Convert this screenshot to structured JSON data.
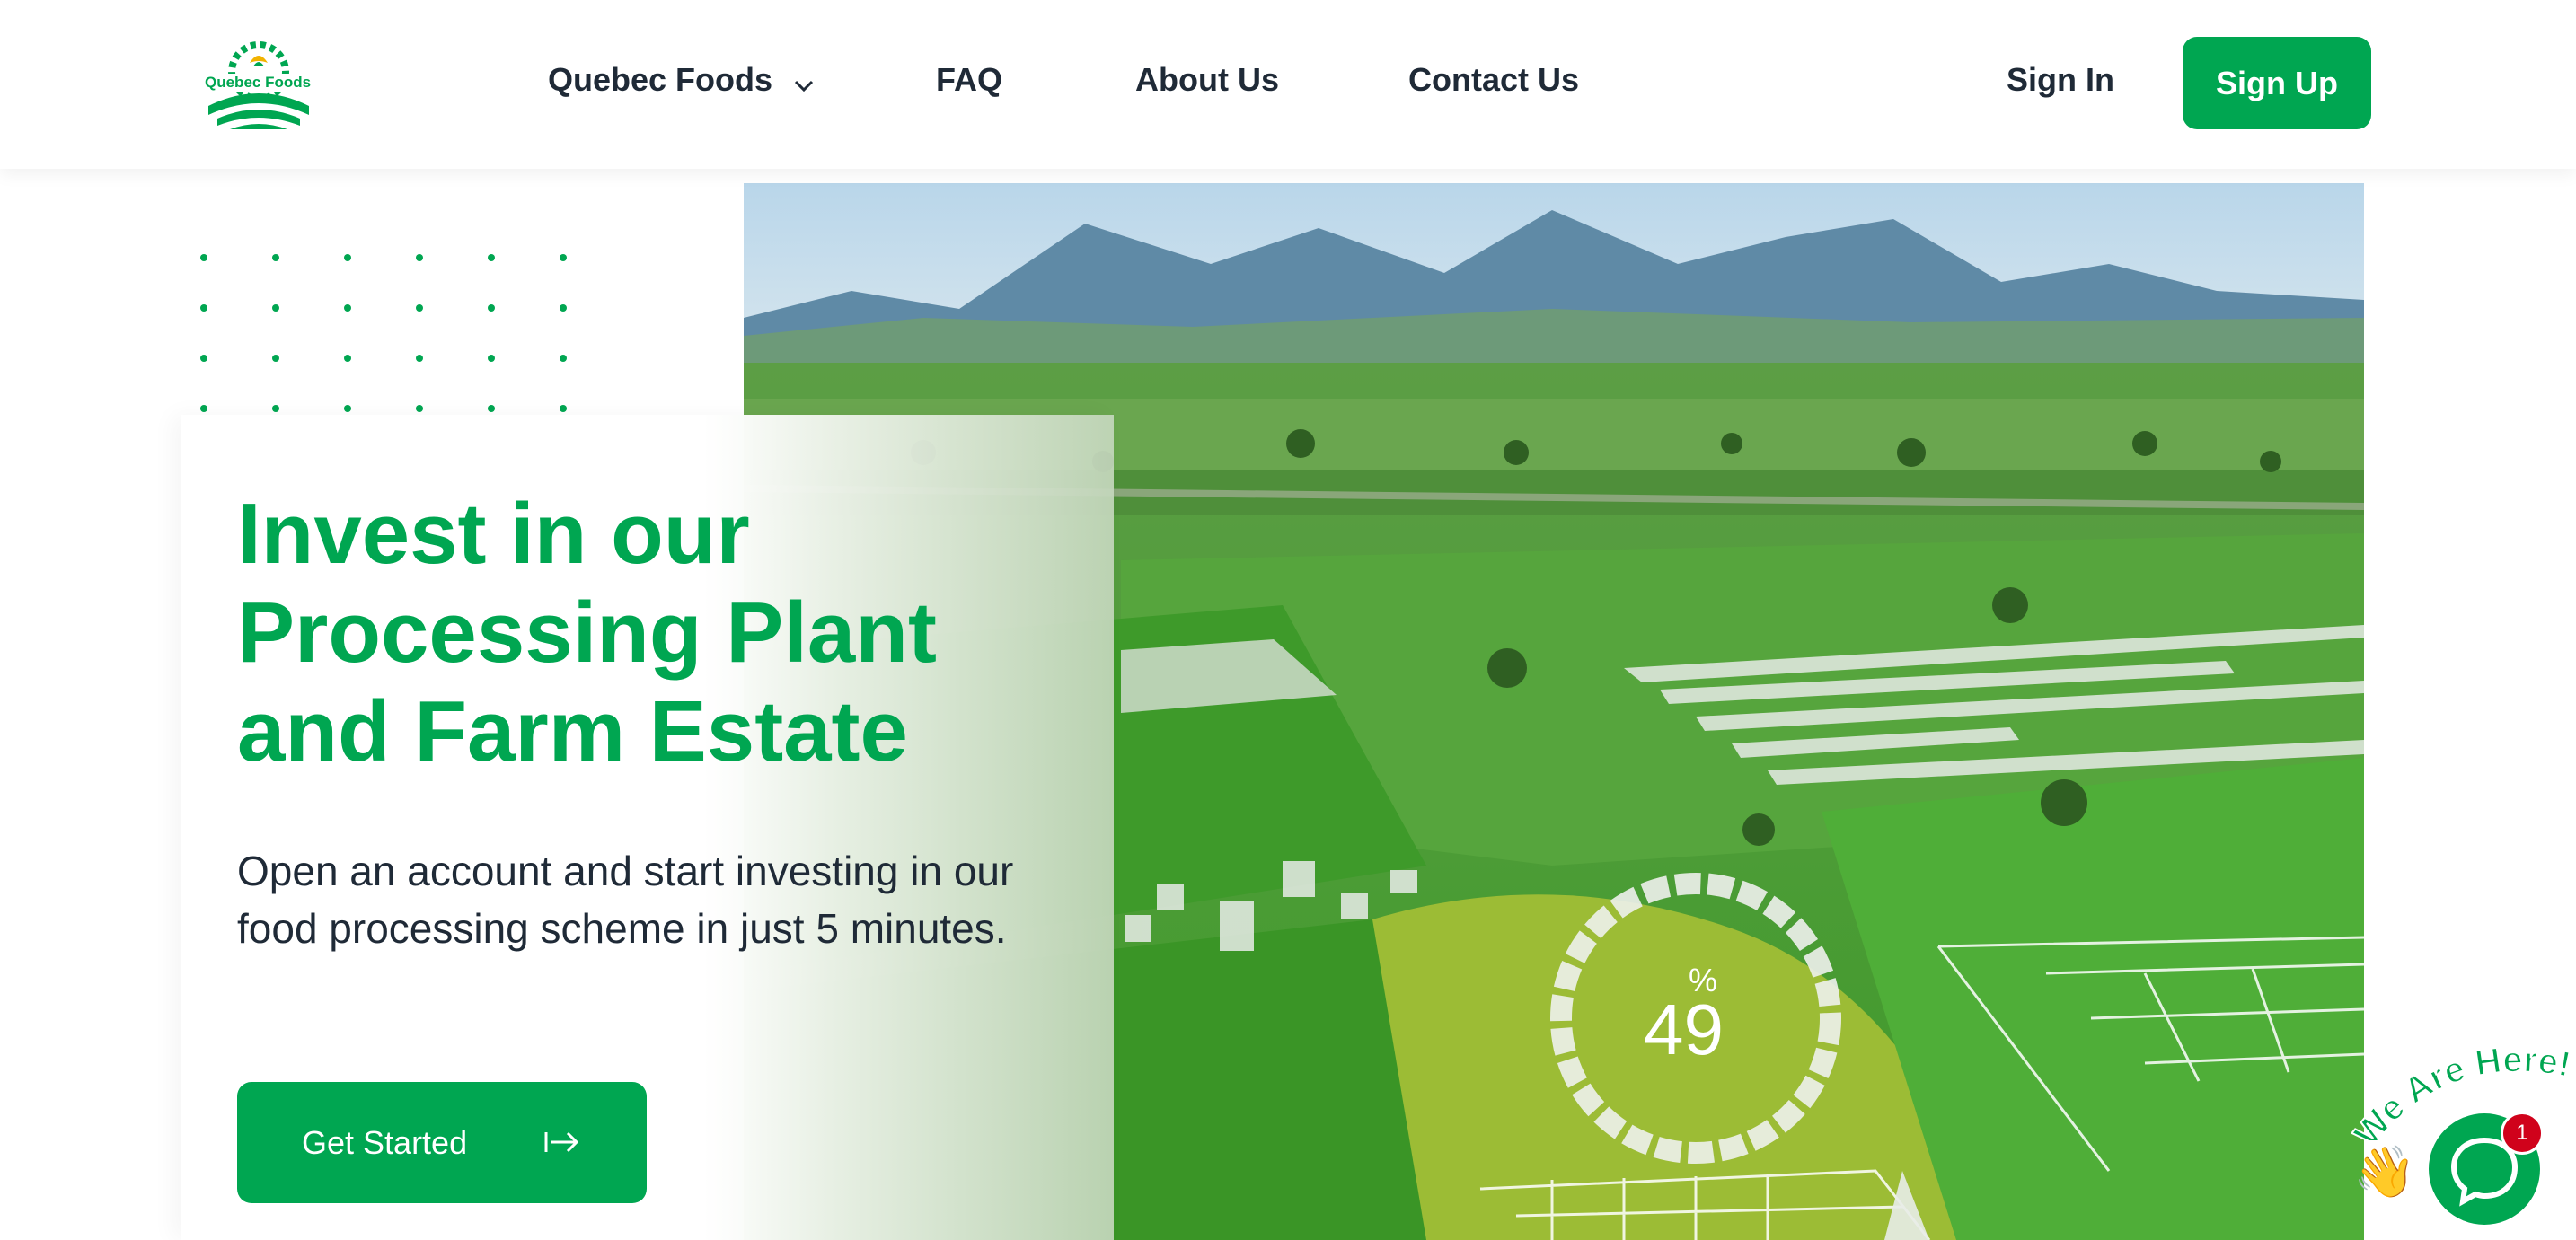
{
  "header": {
    "logo_alt": "Quebec Foods",
    "nav": [
      {
        "label": "Quebec Foods",
        "has_dropdown": true
      },
      {
        "label": "FAQ"
      },
      {
        "label": "About Us"
      },
      {
        "label": "Contact Us"
      }
    ],
    "sign_in": "Sign In",
    "sign_up": "Sign Up"
  },
  "hero": {
    "headline": "Invest in our Processing Plant and Farm Estate",
    "subtext": "Open an account and start investing in our food processing scheme in just 5 minutes.",
    "cta_label": "Get Started",
    "overlay_percent": "49",
    "overlay_symbol": "%"
  },
  "chat": {
    "teaser": "We Are Here!",
    "badge_count": "1",
    "wave_emoji": "👋"
  },
  "colors": {
    "brand_green": "#00a651",
    "text_dark": "#1f2a37",
    "badge_red": "#d0021b"
  }
}
